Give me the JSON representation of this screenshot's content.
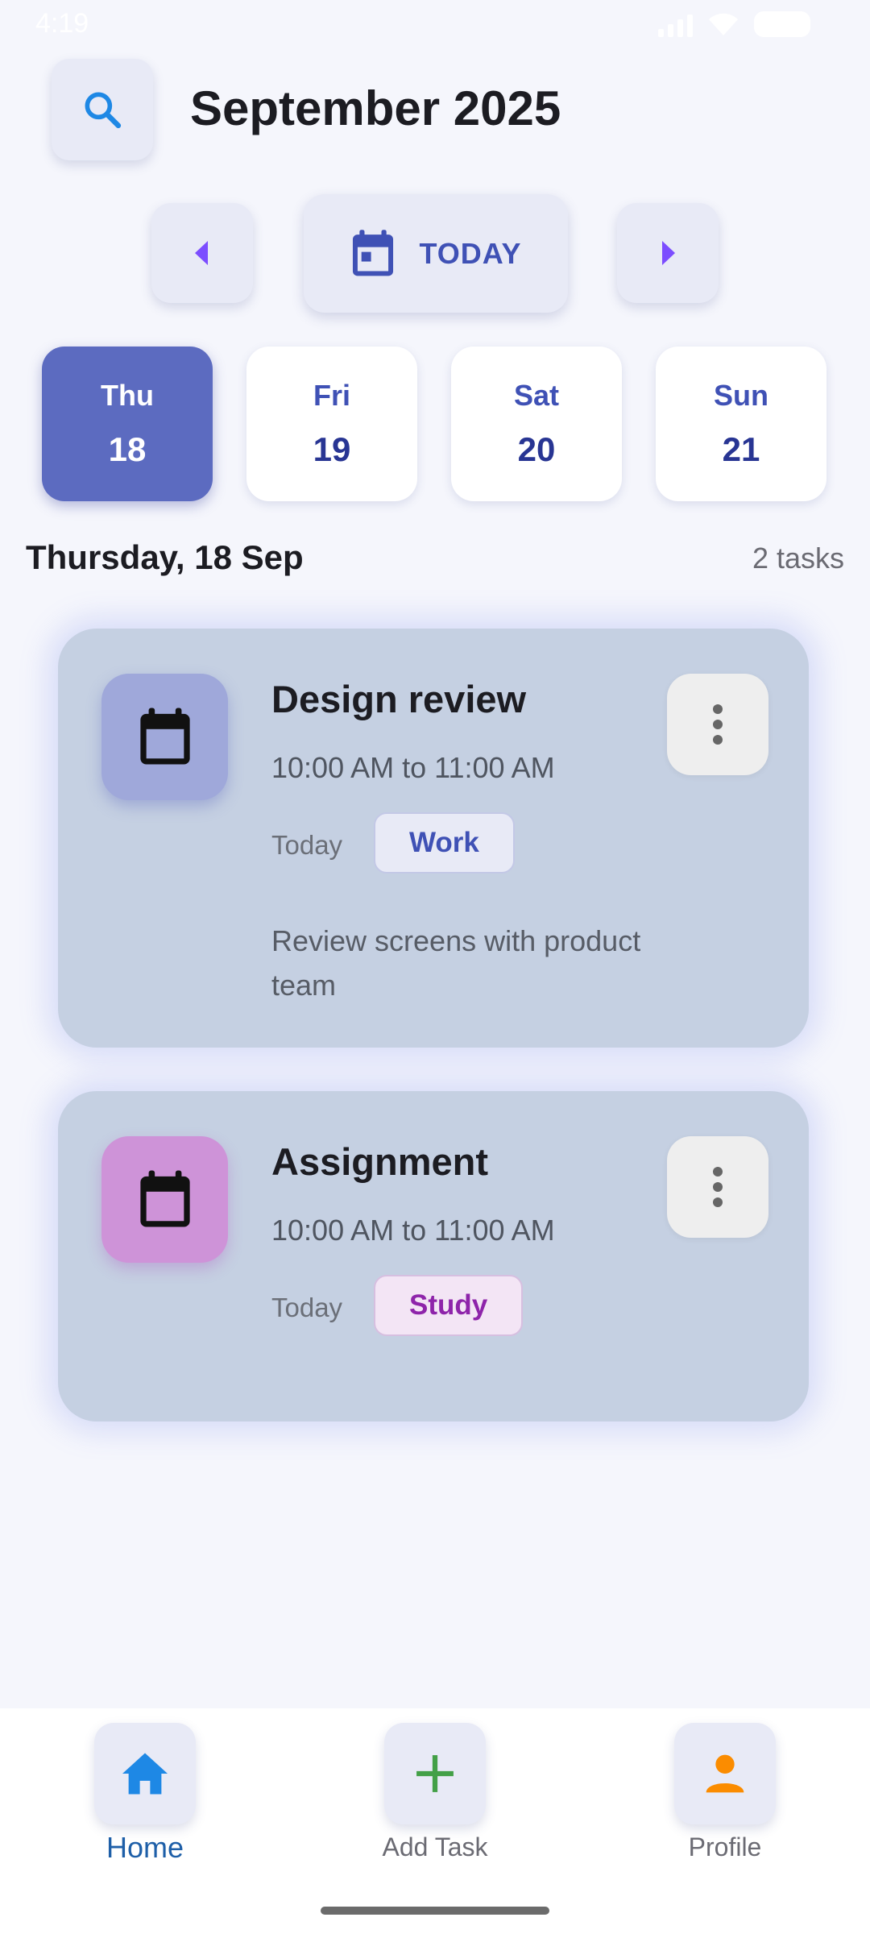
{
  "status_bar": {
    "time": "4:19"
  },
  "header": {
    "title": "September 2025",
    "search_icon": "search-icon"
  },
  "date_nav": {
    "today_label": "TODAY",
    "prev_icon": "arrow-left-icon",
    "next_icon": "arrow-right-icon"
  },
  "days": [
    {
      "name": "Thu",
      "number": "18",
      "selected": true
    },
    {
      "name": "Fri",
      "number": "19",
      "selected": false
    },
    {
      "name": "Sat",
      "number": "20",
      "selected": false
    },
    {
      "name": "Sun",
      "number": "21",
      "selected": false
    }
  ],
  "section": {
    "title": "Thursday, 18 Sep",
    "count": "2 tasks"
  },
  "tasks": [
    {
      "title": "Design review",
      "time": "10:00 AM to 11:00 AM",
      "date": "Today",
      "tag": "Work",
      "note": "Review screens with product team",
      "icon": "calendar-icon",
      "tag_color": "#3f51b5",
      "icon_bg": "#9fa8da"
    },
    {
      "title": "Assignment",
      "time": "10:00 AM to 11:00 AM",
      "date": "Today",
      "tag": "Study",
      "icon": "calendar-icon",
      "tag_color": "#8e24aa",
      "icon_bg": "#ce93d8"
    }
  ],
  "bottom_nav": [
    {
      "label": "Home",
      "icon": "home-icon",
      "active": true,
      "color": "#1e88e5"
    },
    {
      "label": "Add Task",
      "icon": "plus-icon",
      "active": false,
      "color": "#43a047"
    },
    {
      "label": "Profile",
      "icon": "person-icon",
      "active": false,
      "color": "#fb8c00"
    }
  ],
  "colors": {
    "accent": "#3f51b5",
    "selected_day": "#5c6bc0",
    "background": "#f5f6fc"
  }
}
